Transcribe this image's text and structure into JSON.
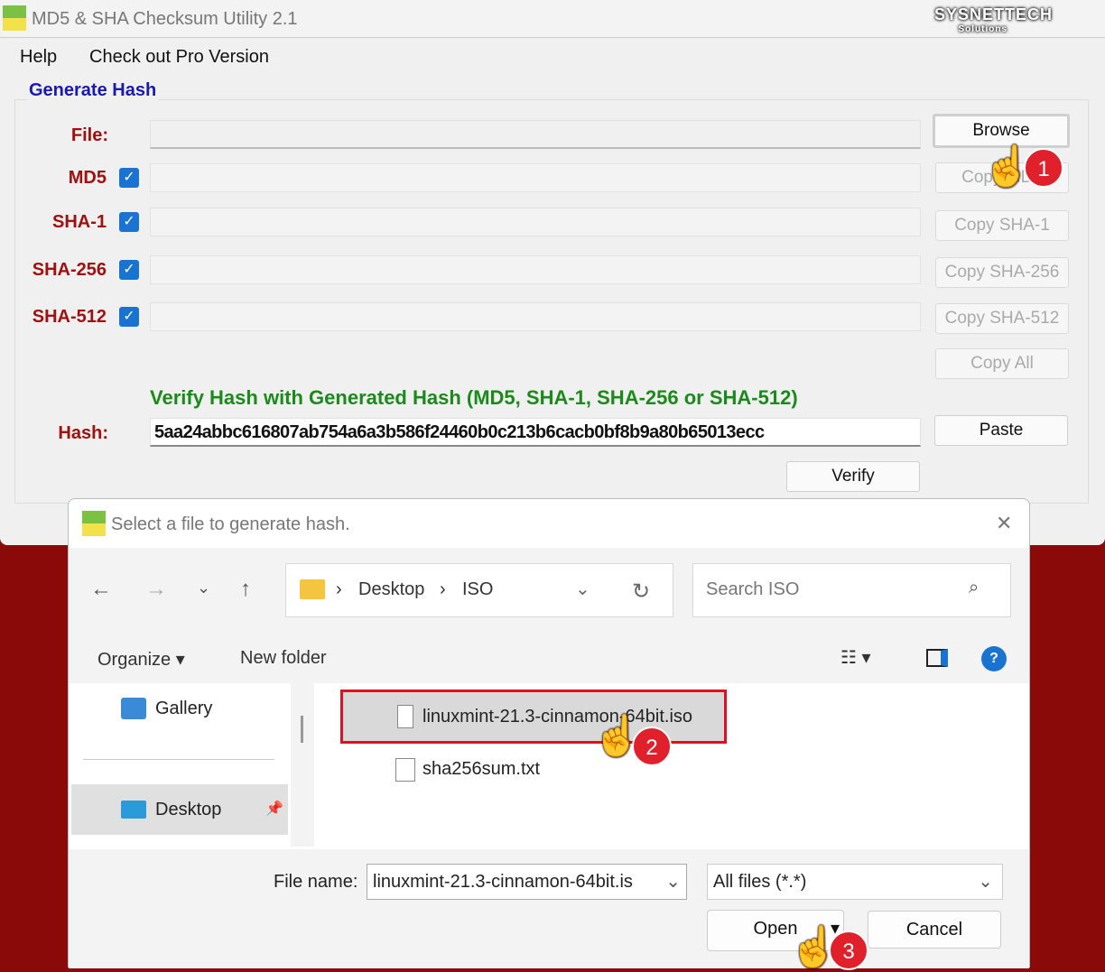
{
  "app": {
    "title": "MD5 & SHA Checksum Utility 2.1",
    "icon_text": "MD5 SHA",
    "watermark": "SYSNETTECH Solutions",
    "menu": [
      "Help",
      "Check out Pro Version"
    ],
    "group_title": "Generate Hash",
    "file_label": "File:",
    "file_value": "",
    "browse": "Browse",
    "rows": [
      {
        "label": "MD5",
        "checked": true,
        "button": "Copy MD5"
      },
      {
        "label": "SHA-1",
        "checked": true,
        "button": "Copy SHA-1"
      },
      {
        "label": "SHA-256",
        "checked": true,
        "button": "Copy SHA-256"
      },
      {
        "label": "SHA-512",
        "checked": true,
        "button": "Copy SHA-512"
      }
    ],
    "copy_all": "Copy All",
    "verify_title": "Verify Hash with Generated Hash (MD5, SHA-1, SHA-256 or SHA-512)",
    "hash_label": "Hash:",
    "hash_value": "5aa24abbc616807ab754a6a3b586f24460b0c213b6cacb0bf8b9a80b65013ecc",
    "paste": "Paste",
    "verify": "Verify"
  },
  "dialog": {
    "title": "Select a file to generate hash.",
    "breadcrumb": [
      "Desktop",
      "ISO"
    ],
    "search_placeholder": "Search ISO",
    "organize": "Organize",
    "new_folder": "New folder",
    "sidebar": [
      "Gallery",
      "Desktop"
    ],
    "files": [
      "linuxmint-21.3-cinnamon-64bit.iso",
      "sha256sum.txt"
    ],
    "file_name_label": "File name:",
    "file_name_value": "linuxmint-21.3-cinnamon-64bit.is",
    "filter": "All files (*.*)",
    "open": "Open",
    "cancel": "Cancel"
  },
  "steps": [
    "1",
    "2",
    "3"
  ],
  "colors": {
    "highlight": "#e01020",
    "label": "#a01010",
    "group_title": "#1a1ab0",
    "verify_title": "#1a8a1a",
    "checkbox": "#1a73d0"
  }
}
